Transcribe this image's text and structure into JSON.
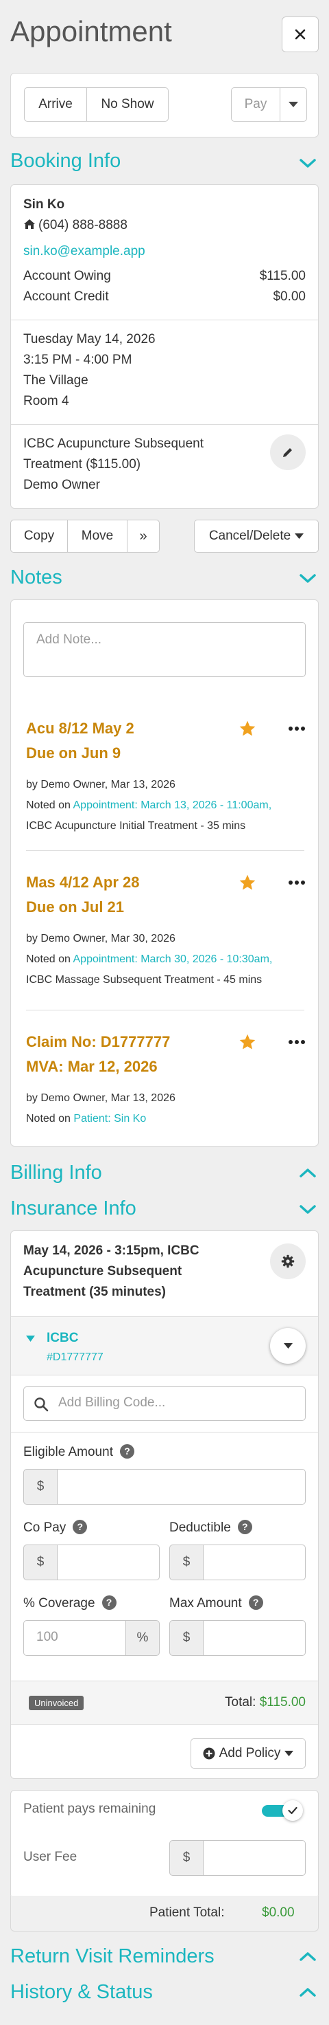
{
  "header": {
    "title": "Appointment",
    "close_icon": "close-icon"
  },
  "status_buttons": {
    "arrive": "Arrive",
    "no_show": "No Show",
    "pay": "Pay"
  },
  "booking": {
    "section_title": "Booking Info",
    "patient_name": "Sin Ko",
    "phone": "(604) 888-8888",
    "email": "sin.ko@example.app",
    "account_owing_label": "Account Owing",
    "account_owing_value": "$115.00",
    "account_credit_label": "Account Credit",
    "account_credit_value": "$0.00",
    "date": "Tuesday May 14, 2026",
    "time": "3:15 PM - 4:00 PM",
    "location": "The Village",
    "room": "Room 4",
    "treatment_line1": "ICBC Acupuncture Subsequent",
    "treatment_line2": "Treatment ($115.00)",
    "practitioner": "Demo Owner"
  },
  "actions": {
    "copy": "Copy",
    "move": "Move",
    "more": "»",
    "cancel_delete": "Cancel/Delete"
  },
  "notes": {
    "section_title": "Notes",
    "placeholder": "Add Note...",
    "items": [
      {
        "title1": "Acu 8/12 May 2",
        "title2": "Due on Jun 9",
        "meta": "by Demo Owner, Mar 13, 2026",
        "noted_prefix": "Noted on",
        "link1": "Appointment: March 13, 2026 - 11:00am,",
        "link2": "ICBC Acupuncture Initial Treatment - 35 mins"
      },
      {
        "title1": "Mas 4/12 Apr 28",
        "title2": "Due on Jul 21",
        "meta": "by Demo Owner, Mar 30, 2026",
        "noted_prefix": "Noted on",
        "link1": "Appointment: March 30, 2026 - 10:30am,",
        "link2": "ICBC Massage Subsequent Treatment - 45 mins"
      },
      {
        "title1": "Claim No: D1777777",
        "title2": "MVA: Mar 12, 2026",
        "meta": "by Demo Owner, Mar 13, 2026",
        "noted_prefix": "Noted on",
        "link1": "Patient: Sin Ko",
        "link2": ""
      }
    ]
  },
  "billing": {
    "section_title": "Billing Info"
  },
  "insurance": {
    "section_title": "Insurance Info",
    "appt_line1": "May 14, 2026 - 3:15pm, ICBC",
    "appt_line2": "Acupuncture Subsequent",
    "appt_line3": "Treatment (35 minutes)",
    "policy_name": "ICBC",
    "policy_number": "#D1777777",
    "billing_code_placeholder": "Add Billing Code...",
    "eligible_amount_label": "Eligible Amount",
    "co_pay_label": "Co Pay",
    "deductible_label": "Deductible",
    "coverage_label": "% Coverage",
    "coverage_placeholder": "100",
    "max_amount_label": "Max Amount",
    "currency_symbol": "$",
    "percent_symbol": "%",
    "help_symbol": "?",
    "status_badge": "Uninvoiced",
    "total_label": "Total:",
    "total_value": "$115.00",
    "add_policy": "Add Policy",
    "patient_pays_remaining": "Patient pays remaining",
    "patient_pays_enabled": true,
    "user_fee_label": "User Fee",
    "patient_total_label": "Patient Total:",
    "patient_total_value": "$0.00"
  },
  "return_reminders": {
    "section_title": "Return Visit Reminders"
  },
  "history": {
    "section_title": "History & Status"
  },
  "colors": {
    "accent": "#1bb6bf",
    "note_title": "#c8860b",
    "star": "#f0a11f",
    "money_green": "#3a9a3a"
  }
}
